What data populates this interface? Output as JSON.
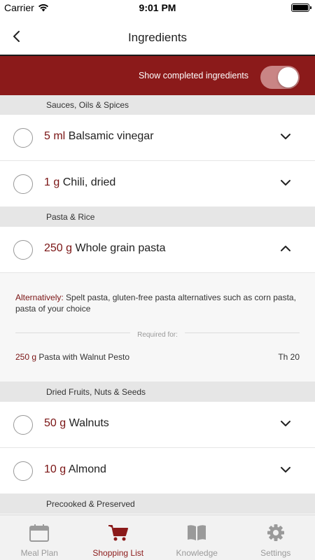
{
  "status": {
    "carrier": "Carrier",
    "time": "9:01 PM"
  },
  "nav": {
    "title": "Ingredients"
  },
  "toggle": {
    "label": "Show completed ingredients",
    "on": true
  },
  "sections": [
    {
      "title": "Sauces, Oils & Spices"
    },
    {
      "title": "Pasta & Rice"
    },
    {
      "title": "Dried Fruits, Nuts & Seeds"
    },
    {
      "title": "Precooked & Preserved"
    }
  ],
  "items": [
    {
      "qty": "5 ml",
      "name": "Balsamic vinegar"
    },
    {
      "qty": "1 g",
      "name": "Chili, dried"
    },
    {
      "qty": "250 g",
      "name": "Whole grain pasta"
    },
    {
      "qty": "50 g",
      "name": "Walnuts"
    },
    {
      "qty": "10 g",
      "name": "Almond"
    }
  ],
  "detail": {
    "alt_label": "Alternatively:",
    "alt_text": "Spelt pasta, gluten-free pasta alternatives such as corn pasta, pasta of your choice",
    "required_label": "Required for:",
    "recipe_qty": "250 g",
    "recipe_name": "Pasta with Walnut Pesto",
    "recipe_day": "Th 20"
  },
  "tabs": [
    {
      "label": "Meal Plan",
      "icon": "calendar-icon"
    },
    {
      "label": "Shopping List",
      "icon": "cart-icon",
      "active": true
    },
    {
      "label": "Knowledge",
      "icon": "book-icon"
    },
    {
      "label": "Settings",
      "icon": "gear-icon"
    }
  ],
  "colors": {
    "brand": "#8b1a1a",
    "inactive": "#9a9a9a"
  }
}
